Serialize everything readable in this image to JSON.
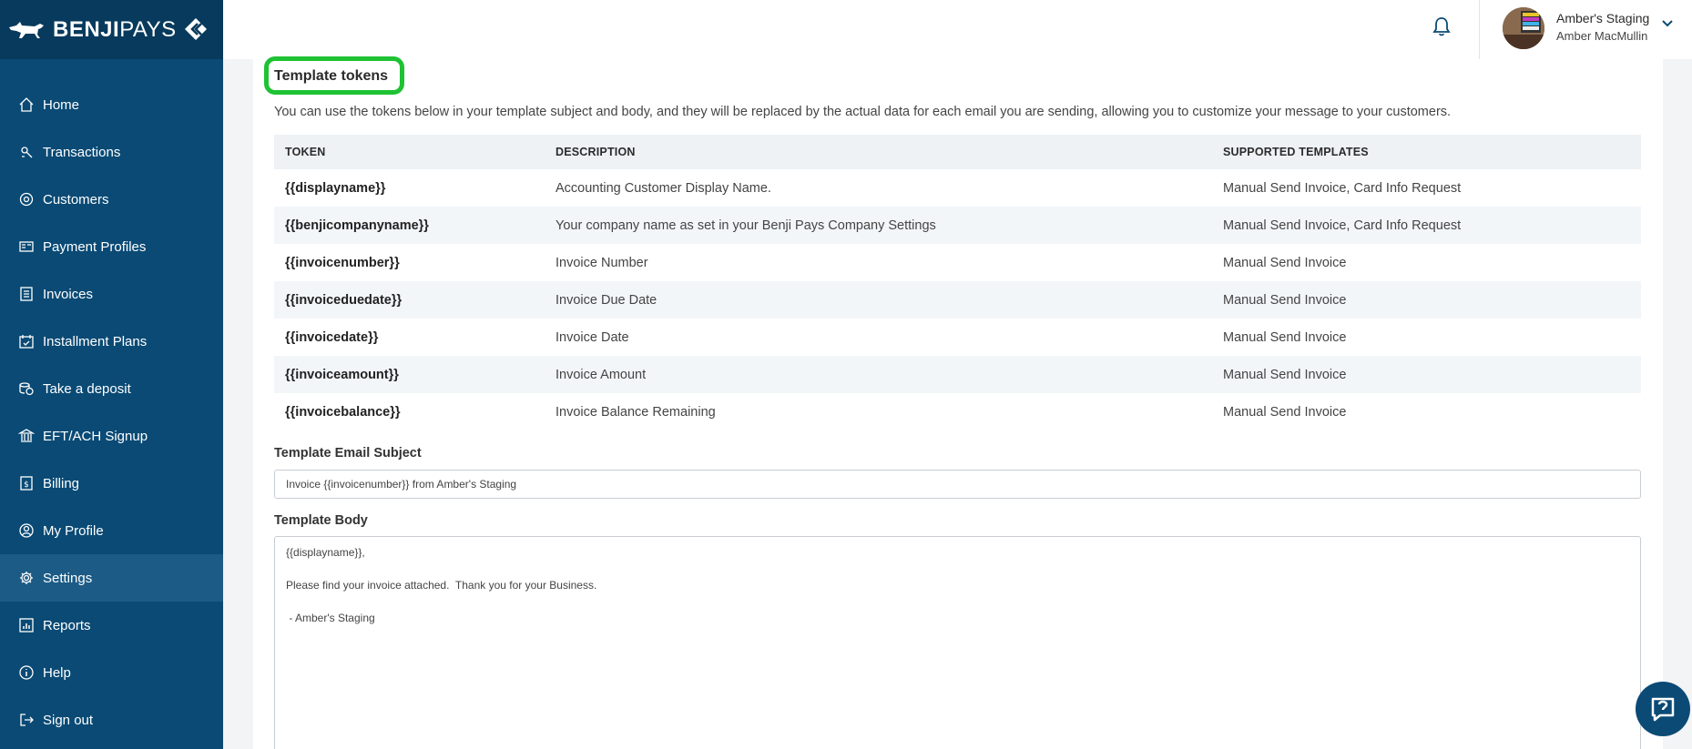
{
  "brand": {
    "logo_bold": "BENJI",
    "logo_light": "PAYS"
  },
  "sidebar": {
    "items": [
      {
        "label": "Home",
        "icon": "home-icon"
      },
      {
        "label": "Transactions",
        "icon": "transactions-icon"
      },
      {
        "label": "Customers",
        "icon": "customers-icon"
      },
      {
        "label": "Payment Profiles",
        "icon": "payment-profiles-icon"
      },
      {
        "label": "Invoices",
        "icon": "invoices-icon"
      },
      {
        "label": "Installment Plans",
        "icon": "calendar-icon"
      },
      {
        "label": "Take a deposit",
        "icon": "coins-icon"
      },
      {
        "label": "EFT/ACH Signup",
        "icon": "bank-icon"
      },
      {
        "label": "Billing",
        "icon": "billing-icon"
      },
      {
        "label": "My Profile",
        "icon": "profile-icon"
      },
      {
        "label": "Settings",
        "icon": "gear-icon",
        "active": true
      },
      {
        "label": "Reports",
        "icon": "reports-icon"
      },
      {
        "label": "Help",
        "icon": "info-icon"
      },
      {
        "label": "Sign out",
        "icon": "sign-out-icon"
      }
    ]
  },
  "header": {
    "org_name": "Amber's Staging",
    "user_name": "Amber MacMullin"
  },
  "section": {
    "title": "Template tokens",
    "intro": "You can use the tokens below in your template subject and body, and they will be replaced by the actual data for each email you are sending, allowing you to customize your message to your customers."
  },
  "table": {
    "headers": [
      "TOKEN",
      "DESCRIPTION",
      "SUPPORTED TEMPLATES"
    ],
    "rows": [
      [
        "{{displayname}}",
        "Accounting Customer Display Name.",
        "Manual Send Invoice, Card Info Request"
      ],
      [
        "{{benjicompanyname}}",
        "Your company name as set in your Benji Pays Company Settings",
        "Manual Send Invoice, Card Info Request"
      ],
      [
        "{{invoicenumber}}",
        "Invoice Number",
        "Manual Send Invoice"
      ],
      [
        "{{invoiceduedate}}",
        "Invoice Due Date",
        "Manual Send Invoice"
      ],
      [
        "{{invoicedate}}",
        "Invoice Date",
        "Manual Send Invoice"
      ],
      [
        "{{invoiceamount}}",
        "Invoice Amount",
        "Manual Send Invoice"
      ],
      [
        "{{invoicebalance}}",
        "Invoice Balance Remaining",
        "Manual Send Invoice"
      ]
    ]
  },
  "form": {
    "subject_label": "Template Email Subject",
    "subject_value": "Invoice {{invoicenumber}} from Amber's Staging",
    "body_label": "Template Body",
    "body_value": "{{displayname}},\n\nPlease find your invoice attached.  Thank you for your Business.\n\n - Amber's Staging"
  },
  "colors": {
    "sidebar": "#0a4a75",
    "sidebar_active": "#1c5b86",
    "highlight": "#1ec233"
  }
}
